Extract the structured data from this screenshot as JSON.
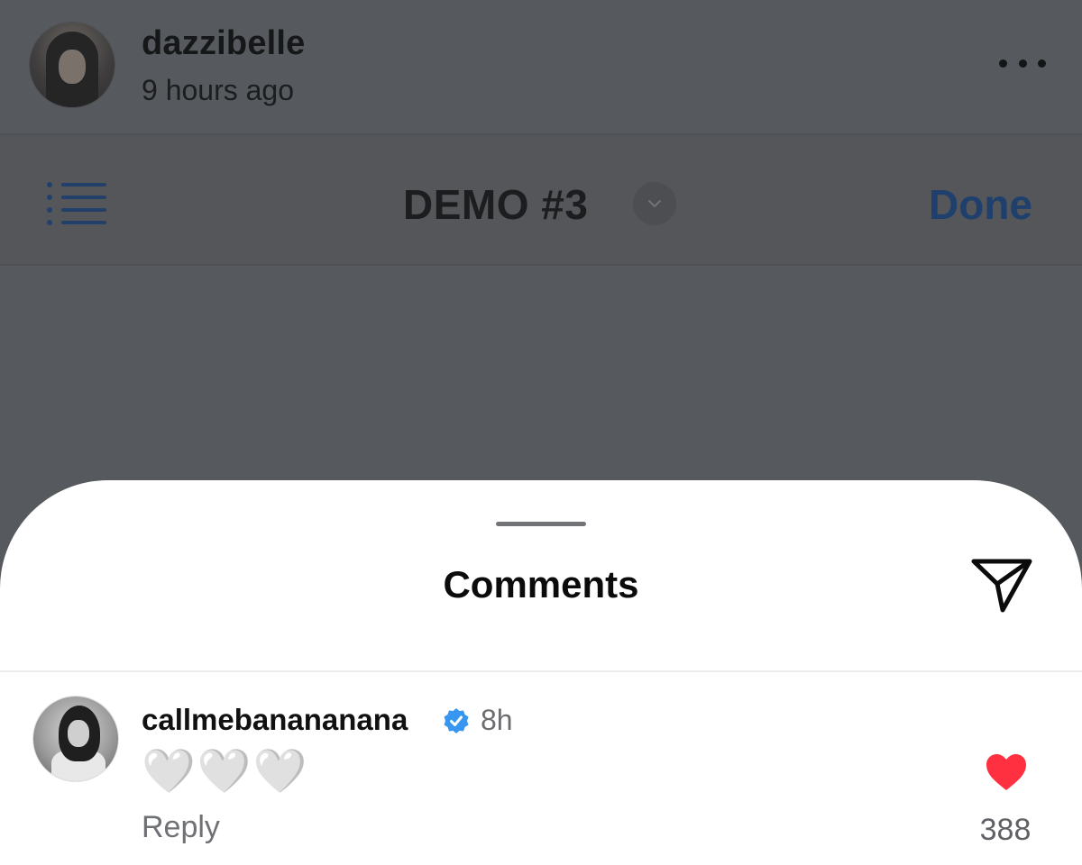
{
  "post": {
    "username": "dazzibelle",
    "time": "9 hours ago"
  },
  "toolbar": {
    "document_title": "DEMO #3",
    "done_label": "Done"
  },
  "sheet": {
    "title": "Comments"
  },
  "comment": {
    "username": "callmebanananana",
    "time": "8h",
    "text": "🤍🤍🤍",
    "reply_label": "Reply",
    "likes": "388"
  },
  "colors": {
    "overlay_dim": "#56595d",
    "verified_blue": "#3797f0",
    "like_red": "#ff3040",
    "toolbar_blue_dimmed": "#1f3f6d"
  },
  "icons": {
    "more": "more-horizontal-icon",
    "list": "list-icon",
    "chevron": "chevron-down-icon",
    "share": "paper-plane-icon",
    "verified": "verified-badge-icon",
    "like": "heart-filled-icon"
  }
}
